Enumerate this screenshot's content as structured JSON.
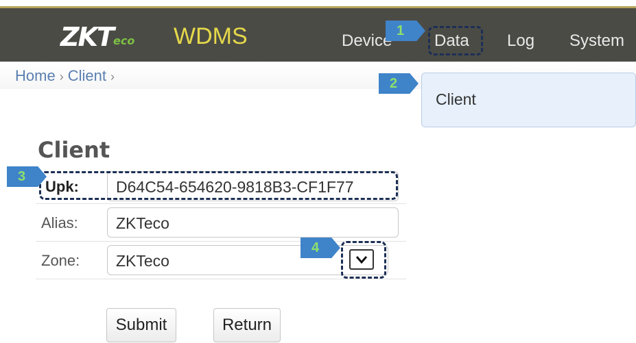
{
  "header": {
    "logo_text": "ZKT",
    "logo_sub": "eco",
    "app_title": "WDMS",
    "nav": [
      "Device",
      "Data",
      "Log",
      "System"
    ]
  },
  "breadcrumb": {
    "home": "Home",
    "client": "Client",
    "sep": "›"
  },
  "dropdown": {
    "items": [
      "Client"
    ]
  },
  "form": {
    "title": "Client",
    "upk_label": "Upk:",
    "upk_value": "D64C54-654620-9818B3-CF1F77",
    "alias_label": "Alias:",
    "alias_value": "ZKTeco",
    "zone_label": "Zone:",
    "zone_value": "ZKTeco",
    "submit_label": "Submit",
    "return_label": "Return"
  },
  "callouts": [
    "1",
    "2",
    "3",
    "4"
  ],
  "icons": {
    "zone_select": "chevron-down-icon"
  }
}
